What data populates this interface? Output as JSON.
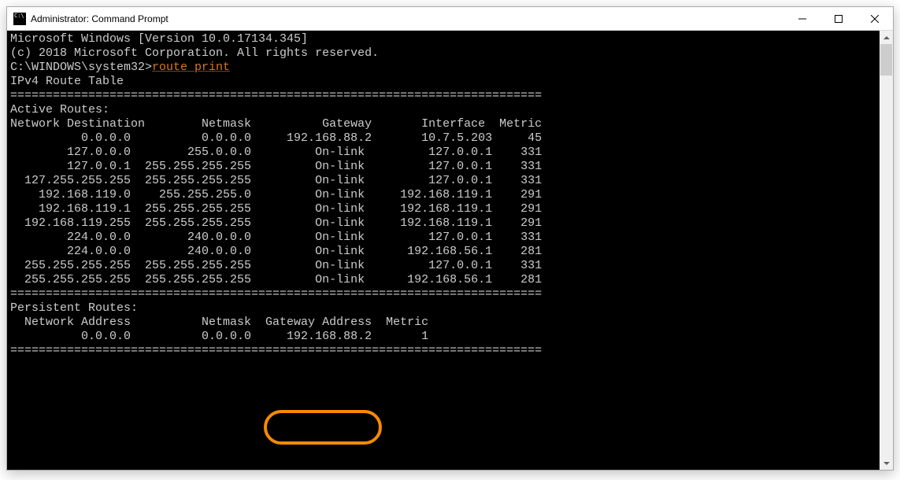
{
  "window": {
    "title": "Administrator: Command Prompt"
  },
  "banner": {
    "line1": "Microsoft Windows [Version 10.0.17134.345]",
    "line2": "(c) 2018 Microsoft Corporation. All rights reserved."
  },
  "prompt": {
    "path": "C:\\WINDOWS\\system32>",
    "command": "route print"
  },
  "blank": "",
  "table": {
    "title": "IPv4 Route Table",
    "hr": "===========================================================================",
    "activeHeader": "Active Routes:",
    "colsLine": "Network Destination        Netmask          Gateway       Interface  Metric",
    "rows": [
      "          0.0.0.0          0.0.0.0     192.168.88.2       10.7.5.203     45",
      "        127.0.0.0        255.0.0.0         On-link         127.0.0.1    331",
      "        127.0.0.1  255.255.255.255         On-link         127.0.0.1    331",
      "  127.255.255.255  255.255.255.255         On-link         127.0.0.1    331",
      "    192.168.119.0    255.255.255.0         On-link     192.168.119.1    291",
      "    192.168.119.1  255.255.255.255         On-link     192.168.119.1    291",
      "  192.168.119.255  255.255.255.255         On-link     192.168.119.1    291",
      "        224.0.0.0        240.0.0.0         On-link         127.0.0.1    331",
      "        224.0.0.0        240.0.0.0         On-link      192.168.56.1    281",
      "  255.255.255.255  255.255.255.255         On-link         127.0.0.1    331",
      "  255.255.255.255  255.255.255.255         On-link      192.168.56.1    281"
    ],
    "persistHeader": "Persistent Routes:",
    "persistCols": "  Network Address          Netmask  Gateway Address  Metric",
    "persistRow": "          0.0.0.0          0.0.0.0     192.168.88.2       1"
  }
}
